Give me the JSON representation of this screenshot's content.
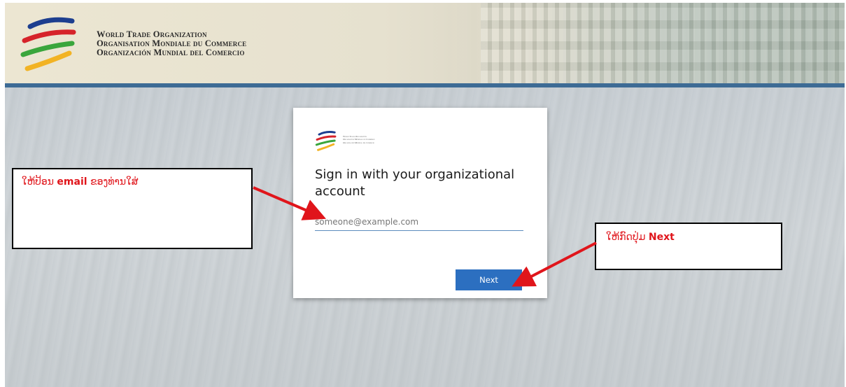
{
  "header": {
    "org_names": [
      "World Trade Organization",
      "Organisation Mondiale du Commerce",
      "Organización Mundial del Comercio"
    ]
  },
  "signin": {
    "title": "Sign in with your organizational account",
    "email_placeholder": "someone@example.com",
    "next_label": "Next"
  },
  "annotations": {
    "email": {
      "prefix": "ໃຫ້ປ້ອນ ",
      "bold": "email",
      "suffix": " ຂອງທ່ານໃສ່"
    },
    "next": {
      "prefix": "ໃຫ້ກົດປຸ່ມ ",
      "bold": "Next"
    }
  },
  "colors": {
    "header_bar": "#3d6b95",
    "button": "#2c6fc0",
    "annotation": "#e0151b",
    "logo_blue": "#1d3e8f",
    "logo_red": "#d6232a",
    "logo_green": "#3aa63c",
    "logo_yellow": "#f2b324"
  }
}
